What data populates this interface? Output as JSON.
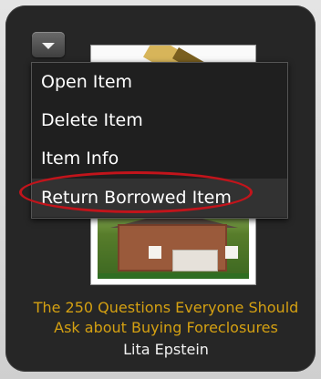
{
  "menu": {
    "toggle_icon": "triangle-down-icon",
    "items": [
      {
        "label": "Open Item",
        "selected": false
      },
      {
        "label": "Delete Item",
        "selected": false
      },
      {
        "label": "Item Info",
        "selected": false
      },
      {
        "label": "Return Borrowed Item",
        "selected": true
      }
    ]
  },
  "book": {
    "title": "The 250 Questions Everyone Should Ask about Buying Foreclosures",
    "author": "Lita Epstein"
  },
  "colors": {
    "tile_background": "#262626",
    "title_color": "#d4a012",
    "author_color": "#f2f2f2",
    "highlight_ring": "#c2141b",
    "menu_background": "#1f1f1f",
    "selected_item_background": "#323232"
  }
}
